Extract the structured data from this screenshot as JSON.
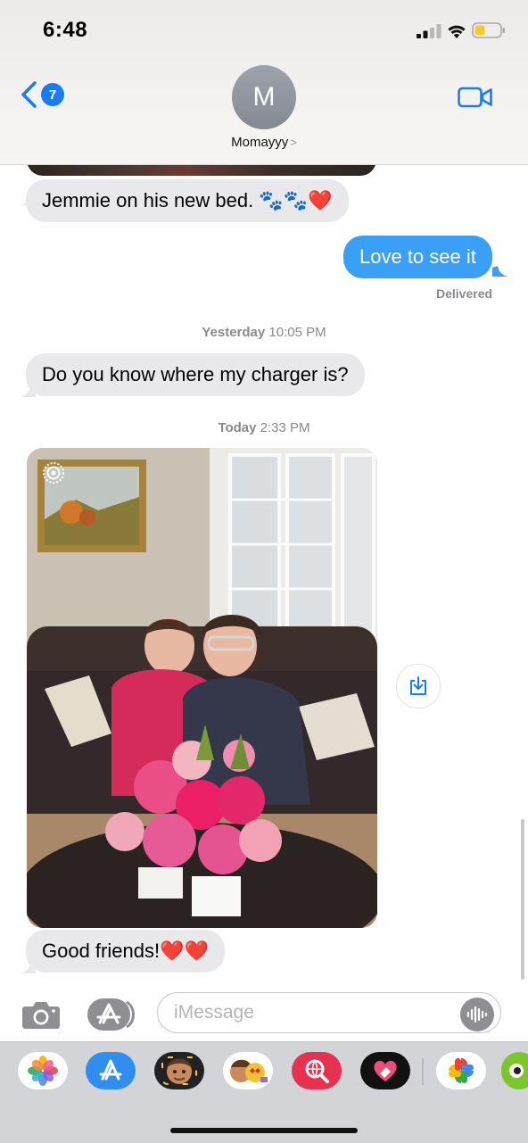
{
  "status": {
    "time": "6:48"
  },
  "header": {
    "back_badge": "7",
    "avatar_initial": "M",
    "contact_name": "Momayyy",
    "chevron": ">"
  },
  "messages": {
    "m1_text": "Jemmie on his new bed. 🐾🐾❤️",
    "m2_text": "Love to see it",
    "m2_status": "Delivered",
    "stamp1_day": "Yesterday",
    "stamp1_time": "10:05 PM",
    "m3_text": "Do you know where my charger is?",
    "stamp2_day": "Today",
    "stamp2_time": "2:33 PM",
    "m5_text": "Good friends!❤️❤️"
  },
  "input": {
    "placeholder": "iMessage"
  },
  "colors": {
    "incoming_bubble": "#e9e9eb",
    "outgoing_bubble": "#3a9ff6",
    "accent": "#1a7cf5"
  },
  "icons": {
    "back": "chevron-left-icon",
    "video": "video-camera-icon",
    "camera": "camera-icon",
    "apps": "app-store-icon",
    "audio": "waveform-icon",
    "save": "save-download-icon",
    "live": "live-photo-icon"
  },
  "drawer_apps": [
    "photos",
    "app-store",
    "memoji",
    "animoji-stickers",
    "image-search",
    "digital-touch",
    "google-photos",
    "duolingo"
  ]
}
